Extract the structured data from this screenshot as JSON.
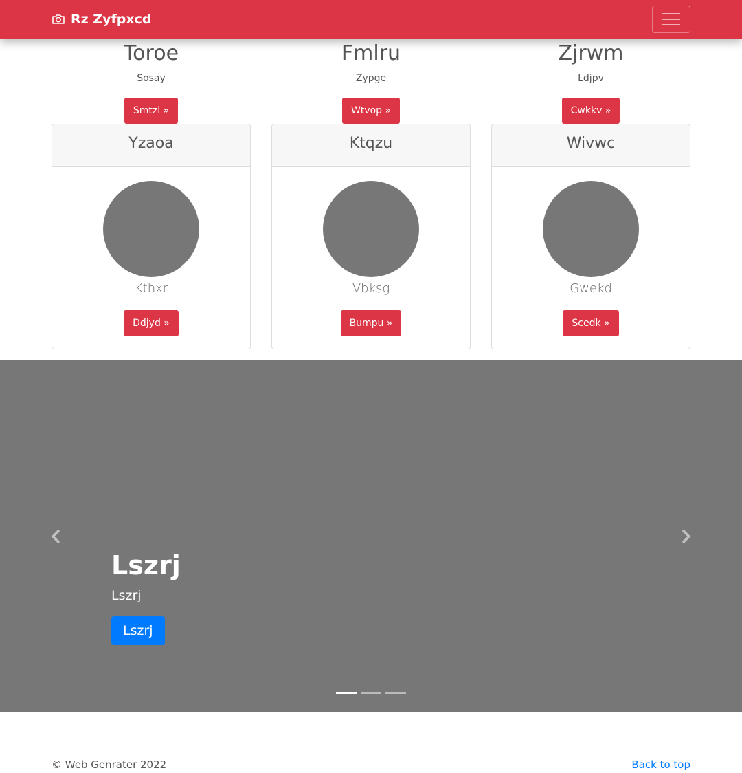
{
  "navbar": {
    "brand": "Rz Zyfpxcd",
    "brand_icon": "camera-icon",
    "toggler_icon": "hamburger-icon",
    "color": "#dc3545"
  },
  "top_columns": [
    {
      "title": "Toroe",
      "text": "Sosay",
      "button": "Smtzl »"
    },
    {
      "title": "Fmlru",
      "text": "Zypge",
      "button": "Wtvop »"
    },
    {
      "title": "Zjrwm",
      "text": "Ldjpv",
      "button": "Cwkkv »"
    }
  ],
  "cards": [
    {
      "header": "Yzaoa",
      "name": "Kthxr",
      "button": "Ddjyd »"
    },
    {
      "header": "Ktqzu",
      "name": "Vbksg",
      "button": "Bumpu »"
    },
    {
      "header": "Wivwc",
      "name": "Gwekd",
      "button": "Scedk »"
    }
  ],
  "carousel": {
    "heading": "Lszrj",
    "text": "Lszrj",
    "button": "Lszrj",
    "prev_icon": "chevron-left-icon",
    "next_icon": "chevron-right-icon",
    "slide_count": 3,
    "active_slide": 1
  },
  "footer": {
    "copyright": "© Web Genrater 2022",
    "back_to_top": "Back to top"
  },
  "colors": {
    "primary_red": "#dc3545",
    "primary_blue": "#007bff",
    "placeholder_gray": "#777777"
  }
}
